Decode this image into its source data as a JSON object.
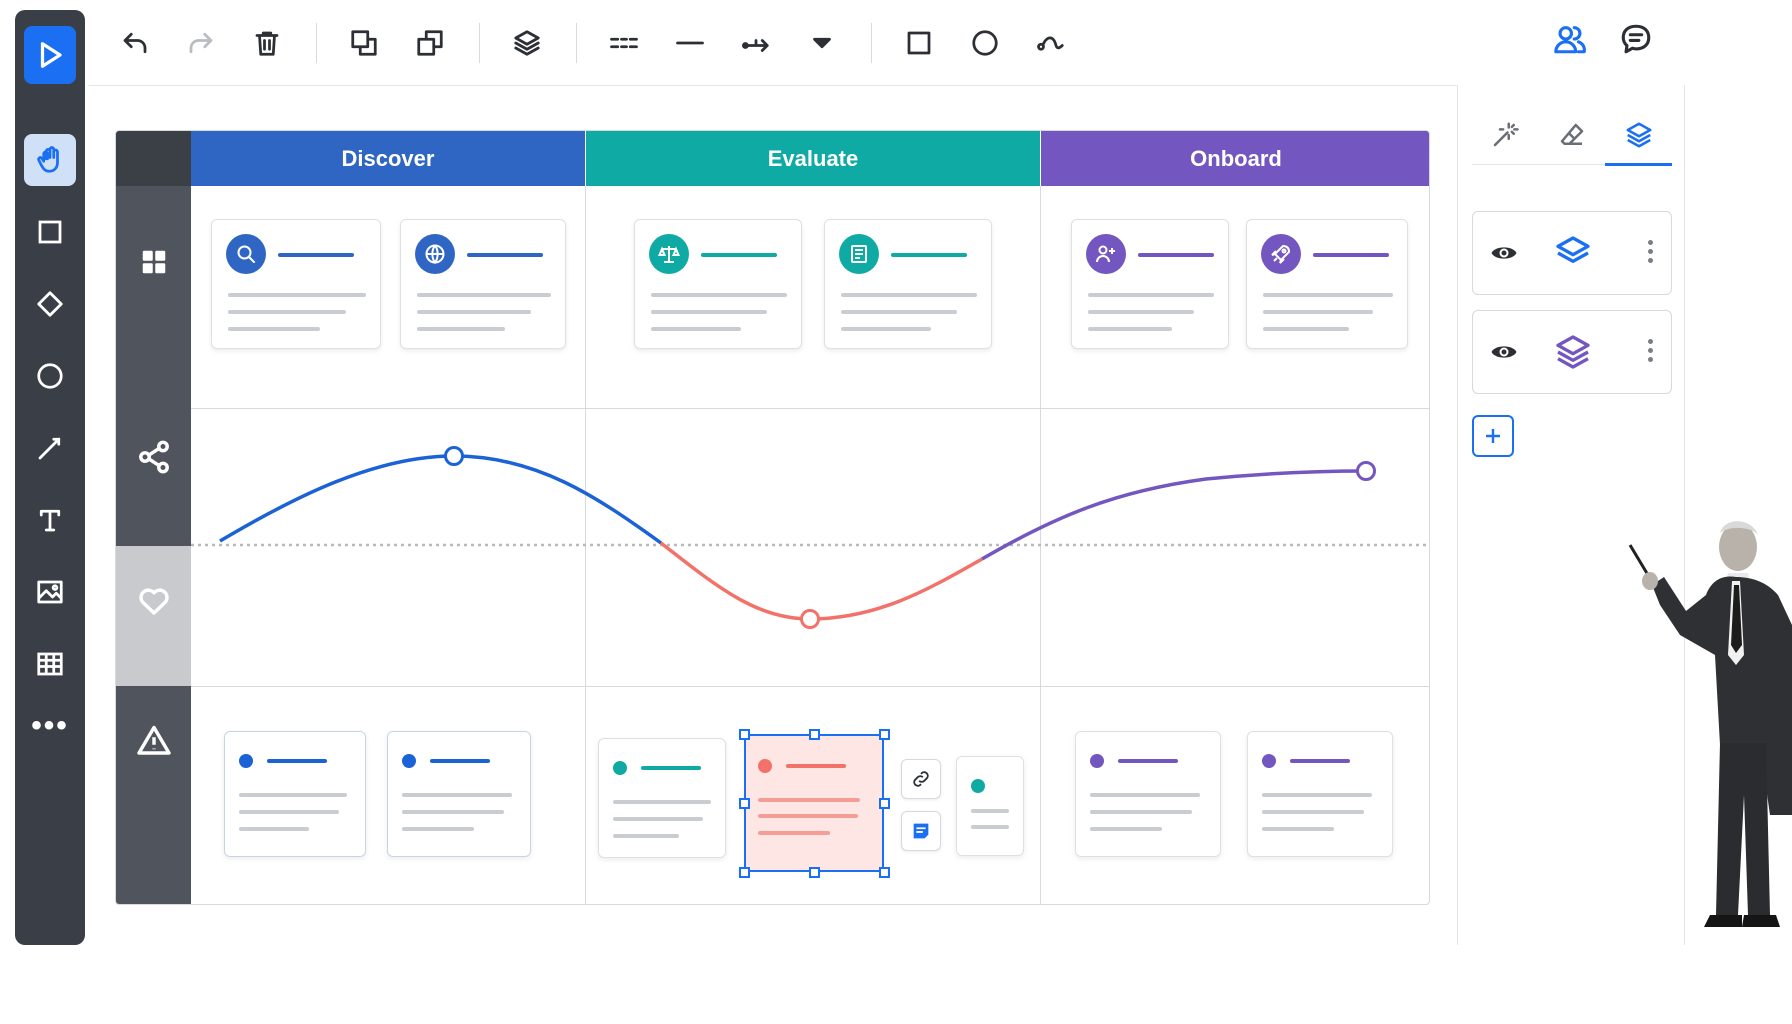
{
  "board": {
    "columns": [
      {
        "label": "Discover",
        "color": "#2f66c4"
      },
      {
        "label": "Evaluate",
        "color": "#10aaa5"
      },
      {
        "label": "Onboard",
        "color": "#7356bf"
      }
    ],
    "row_icons": [
      "grid-icon",
      "share-icon",
      "heart-icon",
      "warning-icon"
    ],
    "card_icons": [
      "search-icon",
      "globe-icon",
      "scale-icon",
      "document-icon",
      "user-plus-icon",
      "rocket-icon"
    ],
    "curve_colors": {
      "positive_start": "#1a62d6",
      "negative": "#f27169",
      "positive_end": "#7356bf"
    }
  },
  "right_panel": {
    "tabs": [
      "magic-icon",
      "eraser-icon",
      "layers-icon"
    ],
    "layers": [
      {
        "icon": "layers-icon",
        "color": "#1a6ff2"
      },
      {
        "icon": "layers-icon",
        "color": "#7356bf"
      }
    ]
  }
}
